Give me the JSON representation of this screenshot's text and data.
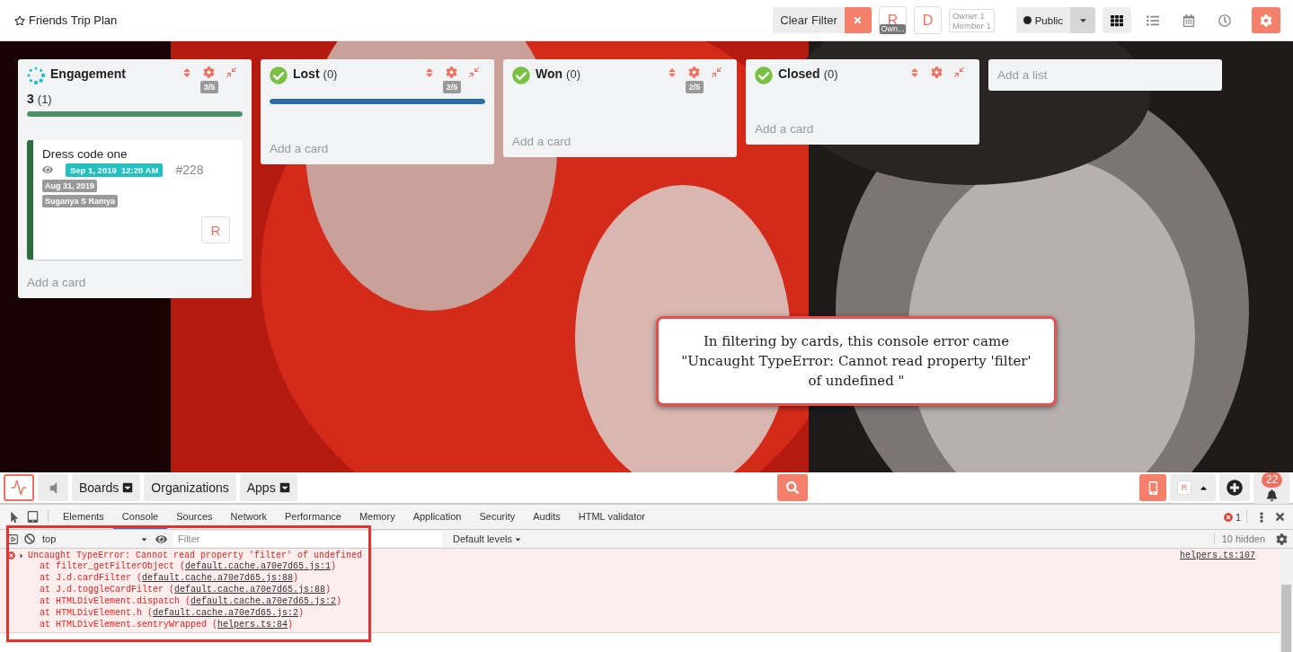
{
  "header": {
    "title": "Friends Trip Plan",
    "clear_filter": "Clear Filter",
    "members": [
      {
        "initial": "R",
        "badge": "Own..."
      },
      {
        "initial": "D"
      }
    ],
    "roles": [
      "Owner 1",
      "Member 1"
    ],
    "visibility": "Public",
    "views": [
      {
        "kind": "grid",
        "selected": true
      },
      {
        "kind": "list",
        "selected": false
      },
      {
        "kind": "calendar",
        "selected": false
      },
      {
        "kind": "clock",
        "selected": false
      }
    ]
  },
  "lists": [
    {
      "title": "Engagement",
      "kind": "progress",
      "total": "3",
      "count": "(1)",
      "wip": "3/5",
      "bar": {
        "color": "#4f8f64",
        "level": 1
      },
      "cards": [
        {
          "title": "Dress code one",
          "color": "#2f6b42",
          "due": "Sep 1, 2019  12:20 AM",
          "number": "#228",
          "labels": [
            "Aug 31, 2019",
            "Suganya S Ramya"
          ],
          "member": "R"
        }
      ],
      "add_card": "Add a card"
    },
    {
      "title": "Lost",
      "kind": "done",
      "count": "(0)",
      "wip": "2/5",
      "bar": {
        "color": "#2c6ea3",
        "level": 1
      },
      "add_card": "Add a card"
    },
    {
      "title": "Won",
      "kind": "done",
      "count": "(0)",
      "wip": "2/5",
      "add_card": "Add a card"
    },
    {
      "title": "Closed",
      "kind": "done",
      "count": "(0)",
      "add_card": "Add a card"
    }
  ],
  "add_list": {
    "placeholder": "Add a list"
  },
  "callout": "In filtering by cards, this console error came \"Uncaught TypeError: Cannot read property 'filter' of undefined \"",
  "bottom_nav": {
    "menus": [
      {
        "label": "Boards",
        "dropdown": true
      },
      {
        "label": "Organizations",
        "dropdown": false
      },
      {
        "label": "Apps",
        "dropdown": true
      }
    ],
    "user_initial": "R",
    "notifications": "22"
  },
  "devtools": {
    "tabs": [
      {
        "label": "Elements",
        "selected": false
      },
      {
        "label": "Console",
        "selected": true
      },
      {
        "label": "Sources",
        "selected": false
      },
      {
        "label": "Network",
        "selected": false
      },
      {
        "label": "Performance",
        "selected": false
      },
      {
        "label": "Memory",
        "selected": false
      },
      {
        "label": "Application",
        "selected": false
      },
      {
        "label": "Security",
        "selected": false
      },
      {
        "label": "Audits",
        "selected": false
      },
      {
        "label": "HTML validator",
        "selected": false
      }
    ],
    "error_count": "1",
    "context": "top",
    "filter": {
      "placeholder": "Filter"
    },
    "levels": "Default levels",
    "hidden": "10 hidden",
    "error": {
      "message": "Uncaught TypeError: Cannot read property 'filter' of undefined",
      "source": "helpers.ts:107",
      "stack": [
        {
          "prefix": "at filter_getFilterObject (",
          "link": "default.cache.a70e7d65.js:1",
          "suffix": ")"
        },
        {
          "prefix": "at J.d.cardFilter (",
          "link": "default.cache.a70e7d65.js:88",
          "suffix": ")"
        },
        {
          "prefix": "at J.d.toggleCardFilter (",
          "link": "default.cache.a70e7d65.js:88",
          "suffix": ")"
        },
        {
          "prefix": "at HTMLDivElement.dispatch (",
          "link": "default.cache.a70e7d65.js:2",
          "suffix": ")"
        },
        {
          "prefix": "at HTMLDivElement.h (",
          "link": "default.cache.a70e7d65.js:2",
          "suffix": ")"
        },
        {
          "prefix": "at HTMLDivElement.sentryWrapped (",
          "link": "helpers.ts:84",
          "suffix": ")"
        }
      ]
    }
  }
}
